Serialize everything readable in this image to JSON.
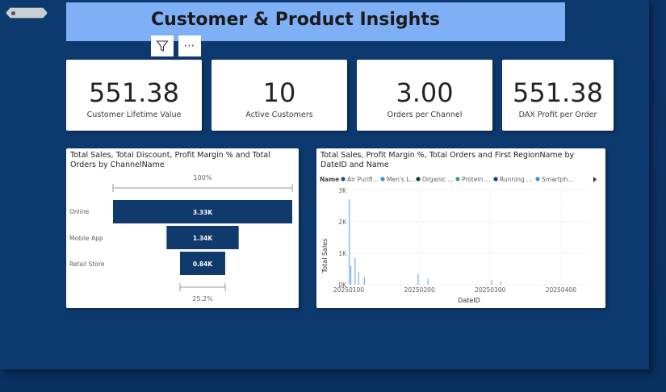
{
  "page": {
    "title": "Customer & Product Insights"
  },
  "icons": {
    "back": "back-arrow-icon",
    "filter": "filter-icon",
    "more": "more-options-icon"
  },
  "more_glyph": "⋯",
  "kpis": [
    {
      "value": "551.38",
      "label": "Customer Lifetime Value"
    },
    {
      "value": "10",
      "label": "Active Customers"
    },
    {
      "value": "3.00",
      "label": "Orders per Channel"
    },
    {
      "value": "551.38",
      "label": "DAX Profit per Order"
    }
  ],
  "colors": {
    "background": "#0d3a6e",
    "title_bar": "#7fb0f5",
    "funnel_bar": "#103a6c",
    "line": "#5aa0e0"
  },
  "chart_data": [
    {
      "type": "bar",
      "subtype": "funnel",
      "title": "Total Sales, Total Discount, Profit Margin % and Total Orders by ChannelName",
      "categories": [
        "Online",
        "Mobile App",
        "Retail Store"
      ],
      "values": [
        3330,
        1340,
        840
      ],
      "data_labels": [
        "3.33K",
        "1.34K",
        "0.84K"
      ],
      "top_label": "100%",
      "bottom_label": "25.2%"
    },
    {
      "type": "line",
      "title": "Total Sales, Profit Margin %, Total Orders and First RegionName by DateID and Name",
      "legend_title": "Name",
      "legend": [
        {
          "name": "Air Purifi...",
          "color": "#1b4f8a"
        },
        {
          "name": "Men's L...",
          "color": "#3a8ee6"
        },
        {
          "name": "Organic ...",
          "color": "#0c3e3a"
        },
        {
          "name": "Protein ...",
          "color": "#3fa06a"
        },
        {
          "name": "Running ...",
          "color": "#143a78"
        },
        {
          "name": "Smartph...",
          "color": "#3d8fe0"
        }
      ],
      "xlabel": "DateID",
      "ylabel": "Total Sales",
      "xticks": [
        "20250100",
        "20250200",
        "20250300",
        "20250400"
      ],
      "yticks": [
        "0K",
        "1K",
        "2K",
        "3K"
      ],
      "ylim": [
        0,
        3000
      ],
      "xlim": [
        20250100,
        20250440
      ],
      "spikes": [
        {
          "x": 20250101,
          "y": 2700
        },
        {
          "x": 20250103,
          "y": 600
        },
        {
          "x": 20250109,
          "y": 850
        },
        {
          "x": 20250114,
          "y": 400
        },
        {
          "x": 20250122,
          "y": 250
        },
        {
          "x": 20250198,
          "y": 350
        },
        {
          "x": 20250212,
          "y": 200
        },
        {
          "x": 20250302,
          "y": 150
        },
        {
          "x": 20250315,
          "y": 100
        }
      ]
    }
  ]
}
